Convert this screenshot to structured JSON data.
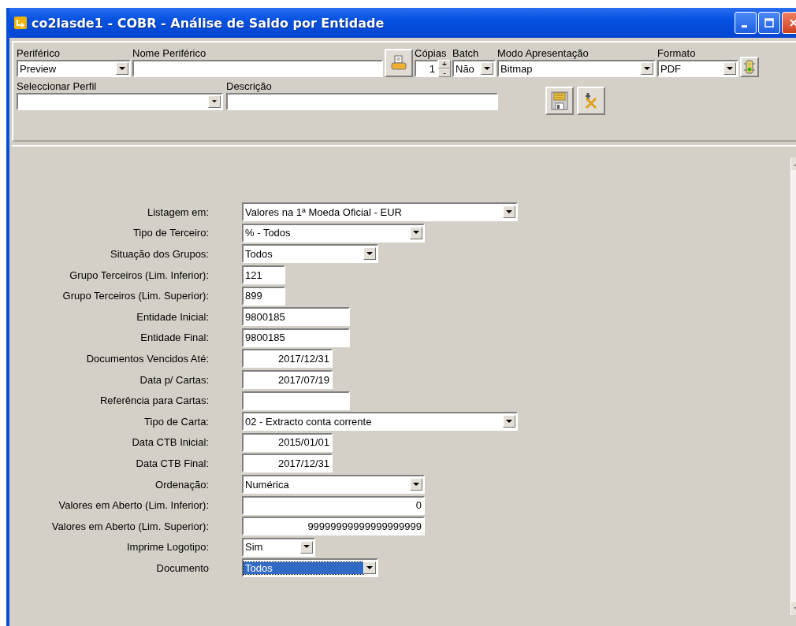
{
  "window": {
    "title": "co2lasde1 - COBR - Análise de Saldo por Entidade"
  },
  "output_panel": {
    "device": {
      "label": "Periférico",
      "value": "Preview"
    },
    "device_name": {
      "label": "Nome Periférico"
    },
    "copies": {
      "label": "Cópias",
      "value": "1",
      "plus": "+",
      "minus": "-"
    },
    "batch": {
      "label": "Batch",
      "value": "Não"
    },
    "mode": {
      "label": "Modo Apresentação",
      "value": "Bitmap"
    },
    "format": {
      "label": "Formato",
      "value": "PDF"
    },
    "profile": {
      "label": "Seleccionar Perfil"
    },
    "description": {
      "label": "Descrição"
    }
  },
  "fields": [
    {
      "label": "Listagem em:",
      "kind": "combo",
      "value": "Valores na 1ª Moeda Oficial - EUR",
      "selected": false
    },
    {
      "label": "Tipo de Terceiro:",
      "kind": "combo",
      "value": "% - Todos",
      "selected": false
    },
    {
      "label": "Situação dos Grupos:",
      "kind": "combo",
      "value": "Todos",
      "selected": false
    },
    {
      "label": "Grupo Terceiros (Lim. Inferior):",
      "kind": "text",
      "value": "121",
      "selected": false
    },
    {
      "label": "Grupo Terceiros (Lim. Superior):",
      "kind": "text",
      "value": "899",
      "selected": false
    },
    {
      "label": "Entidade Inicial:",
      "kind": "text",
      "value": "9800185",
      "selected": false
    },
    {
      "label": "Entidade Final:",
      "kind": "text",
      "value": "9800185",
      "selected": false
    },
    {
      "label": "Documentos Vencidos Até:",
      "kind": "number",
      "value": "2017/12/31",
      "selected": false
    },
    {
      "label": "Data p/ Cartas:",
      "kind": "number",
      "value": "2017/07/19",
      "selected": false
    },
    {
      "label": "Referência para Cartas:",
      "kind": "text",
      "selected": false
    },
    {
      "label": "Tipo de Carta:",
      "kind": "combo",
      "value": "02 - Extracto conta corrente",
      "selected": false
    },
    {
      "label": "Data CTB Inicial:",
      "kind": "number",
      "value": "2015/01/01",
      "selected": false
    },
    {
      "label": "Data CTB Final:",
      "kind": "number",
      "value": "2017/12/31",
      "selected": false
    },
    {
      "label": "Ordenação:",
      "kind": "combo",
      "value": "Numérica",
      "selected": false
    },
    {
      "label": "Valores em Aberto (Lim. Inferior):",
      "kind": "number",
      "value": "0",
      "selected": false
    },
    {
      "label": "Valores em Aberto (Lim. Superior):",
      "kind": "number",
      "value": "99999999999999999999",
      "selected": false
    },
    {
      "label": "Imprime Logotipo:",
      "kind": "combo",
      "value": "Sim",
      "selected": false
    },
    {
      "label": "Documento",
      "kind": "combo",
      "value": "Todos",
      "selected": true
    }
  ]
}
